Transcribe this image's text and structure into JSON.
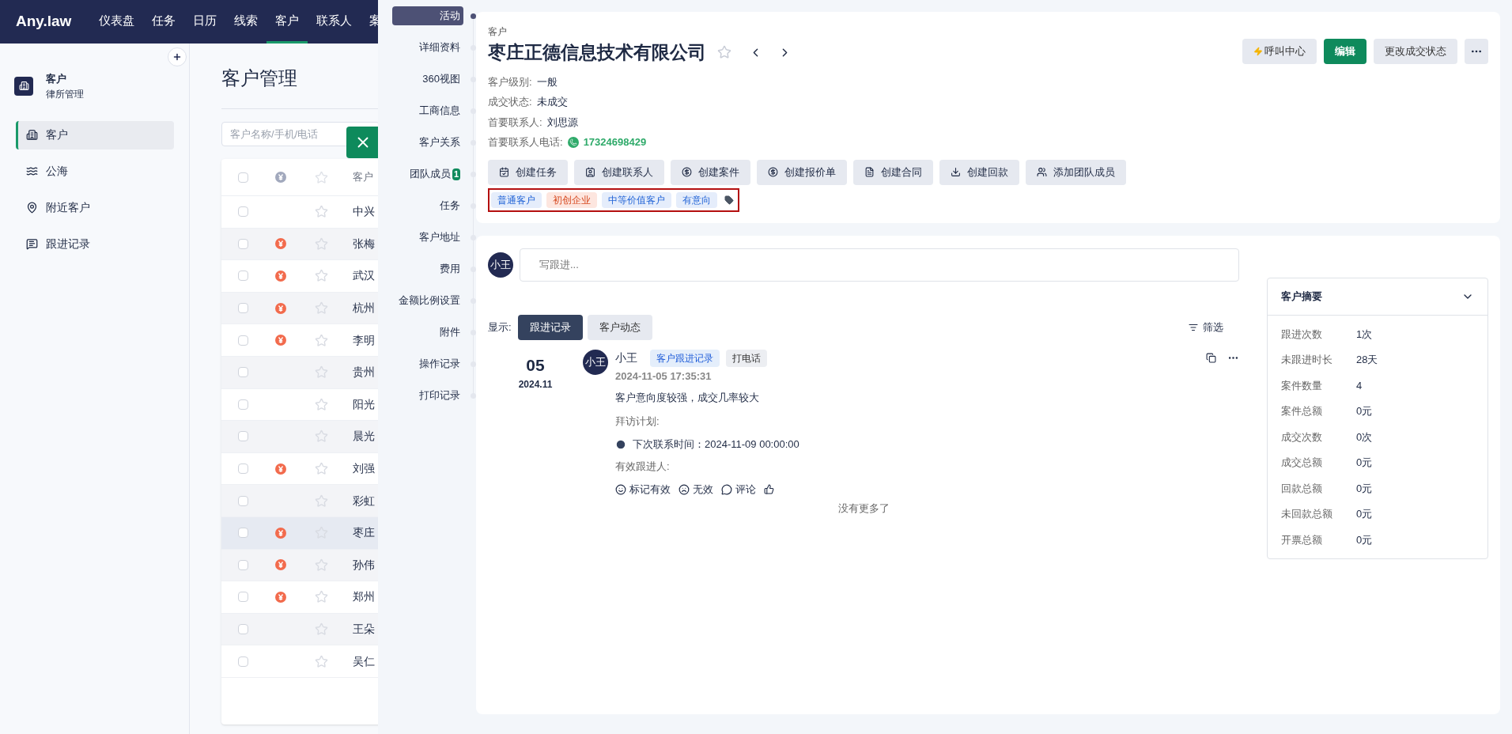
{
  "top_nav": {
    "logo": "Any.law",
    "items": [
      {
        "label": "仪表盘",
        "selected": false
      },
      {
        "label": "任务",
        "selected": false
      },
      {
        "label": "日历",
        "selected": false
      },
      {
        "label": "线索",
        "selected": false
      },
      {
        "label": "客户",
        "selected": true
      },
      {
        "label": "联系人",
        "selected": false
      },
      {
        "label": "案",
        "selected": false
      }
    ]
  },
  "sidebar": {
    "module_title": "客户",
    "module_subtitle": "律所管理",
    "items": [
      {
        "label": "客户",
        "selected": true
      },
      {
        "label": "公海",
        "selected": false
      },
      {
        "label": "附近客户",
        "selected": false
      },
      {
        "label": "跟进记录",
        "selected": false
      }
    ]
  },
  "main": {
    "title": "客户管理",
    "search": {
      "placeholder": "客户名称/手机/电话"
    },
    "table": {
      "all_checked": false,
      "column_4": "客户",
      "rows": [
        {
          "name": "中兴",
          "paid": false,
          "selected": false
        },
        {
          "name": "张梅",
          "paid": true,
          "selected": false
        },
        {
          "name": "武汉",
          "paid": true,
          "selected": false
        },
        {
          "name": "杭州",
          "paid": true,
          "selected": false
        },
        {
          "name": "李明",
          "paid": true,
          "selected": false
        },
        {
          "name": "贵州",
          "paid": false,
          "selected": false
        },
        {
          "name": "阳光",
          "paid": false,
          "selected": false
        },
        {
          "name": "晨光",
          "paid": false,
          "selected": false
        },
        {
          "name": "刘强",
          "paid": true,
          "selected": false
        },
        {
          "name": "彩虹",
          "paid": false,
          "selected": false
        },
        {
          "name": "枣庄",
          "paid": true,
          "selected": true
        },
        {
          "name": "孙伟",
          "paid": true,
          "selected": false
        },
        {
          "name": "郑州",
          "paid": true,
          "selected": false
        },
        {
          "name": "王朵",
          "paid": false,
          "selected": false
        },
        {
          "name": "吴仁",
          "paid": false,
          "selected": false
        }
      ]
    }
  },
  "drawer": {
    "nav": [
      {
        "label": "活动",
        "selected": true
      },
      {
        "label": "详细资料",
        "selected": false
      },
      {
        "label": "360视图",
        "selected": false
      },
      {
        "label": "工商信息",
        "selected": false
      },
      {
        "label": "客户关系",
        "selected": false
      },
      {
        "label": "团队成员",
        "selected": false,
        "badge": "1"
      },
      {
        "label": "任务",
        "selected": false
      },
      {
        "label": "客户地址",
        "selected": false
      },
      {
        "label": "费用",
        "selected": false
      },
      {
        "label": "金额比例设置",
        "selected": false
      },
      {
        "label": "附件",
        "selected": false
      },
      {
        "label": "操作记录",
        "selected": false
      },
      {
        "label": "打印记录",
        "selected": false
      }
    ],
    "header": {
      "caption": "客户",
      "title": "枣庄正德信息技术有限公司",
      "buttons": [
        {
          "label": "呼叫中心",
          "kind": "call"
        },
        {
          "label": "编辑",
          "kind": "primary"
        },
        {
          "label": "更改成交状态",
          "kind": "plain"
        }
      ],
      "fields": [
        {
          "label": "客户级别:",
          "value": "一般"
        },
        {
          "label": "成交状态:",
          "value": "未成交"
        },
        {
          "label": "首要联系人:",
          "value": "刘思源"
        },
        {
          "label": "首要联系人电话:",
          "value": "17324698429",
          "kind": "phone"
        }
      ],
      "actions": [
        "创建任务",
        "创建联系人",
        "创建案件",
        "创建报价单",
        "创建合同",
        "创建回款",
        "添加团队成员"
      ],
      "tags": [
        {
          "label": "普通客户",
          "color": "#e5edfb"
        },
        {
          "label": "初创企业",
          "color": "#fde6df"
        },
        {
          "label": "中等价值客户",
          "color": "#e5edfb"
        },
        {
          "label": "有意向",
          "color": "#e5edfb"
        }
      ]
    },
    "feed": {
      "avatar": "小王",
      "input_placeholder": "写跟进...",
      "show_label": "显示:",
      "tabs": [
        {
          "label": "跟进记录",
          "selected": true
        },
        {
          "label": "客户动态",
          "selected": false
        }
      ],
      "filter": "筛选",
      "entry": {
        "day": "05",
        "month": "2024.11",
        "avatar": "小王",
        "author": "小王",
        "tags": [
          {
            "label": "客户跟进记录",
            "kind": "type"
          },
          {
            "label": "打电话",
            "kind": "method"
          }
        ],
        "time": "2024-11-05 17:35:31",
        "content": "客户意向度较强，成交几率较大",
        "plan_label": "拜访计划:",
        "next_contact": "下次联系时间：2024-11-09 00:00:00",
        "followers_label": "有效跟进人:",
        "actions": [
          {
            "label": "标记有效",
            "kind": "smile"
          },
          {
            "label": "无效",
            "kind": "frown"
          },
          {
            "label": "评论",
            "kind": "comment"
          },
          {
            "kind": "like"
          }
        ]
      },
      "end_text": "没有更多了"
    },
    "summary": {
      "title": "客户摘要",
      "expanded": true,
      "rows": [
        {
          "label": "跟进次数",
          "value": "1次"
        },
        {
          "label": "未跟进时长",
          "value": "28天"
        },
        {
          "label": "案件数量",
          "value": "4"
        },
        {
          "label": "案件总额",
          "value": "0元"
        },
        {
          "label": "成交次数",
          "value": "0次"
        },
        {
          "label": "成交总额",
          "value": "0元"
        },
        {
          "label": "回款总额",
          "value": "0元"
        },
        {
          "label": "未回款总额",
          "value": "0元"
        },
        {
          "label": "开票总额",
          "value": "0元"
        }
      ]
    }
  }
}
